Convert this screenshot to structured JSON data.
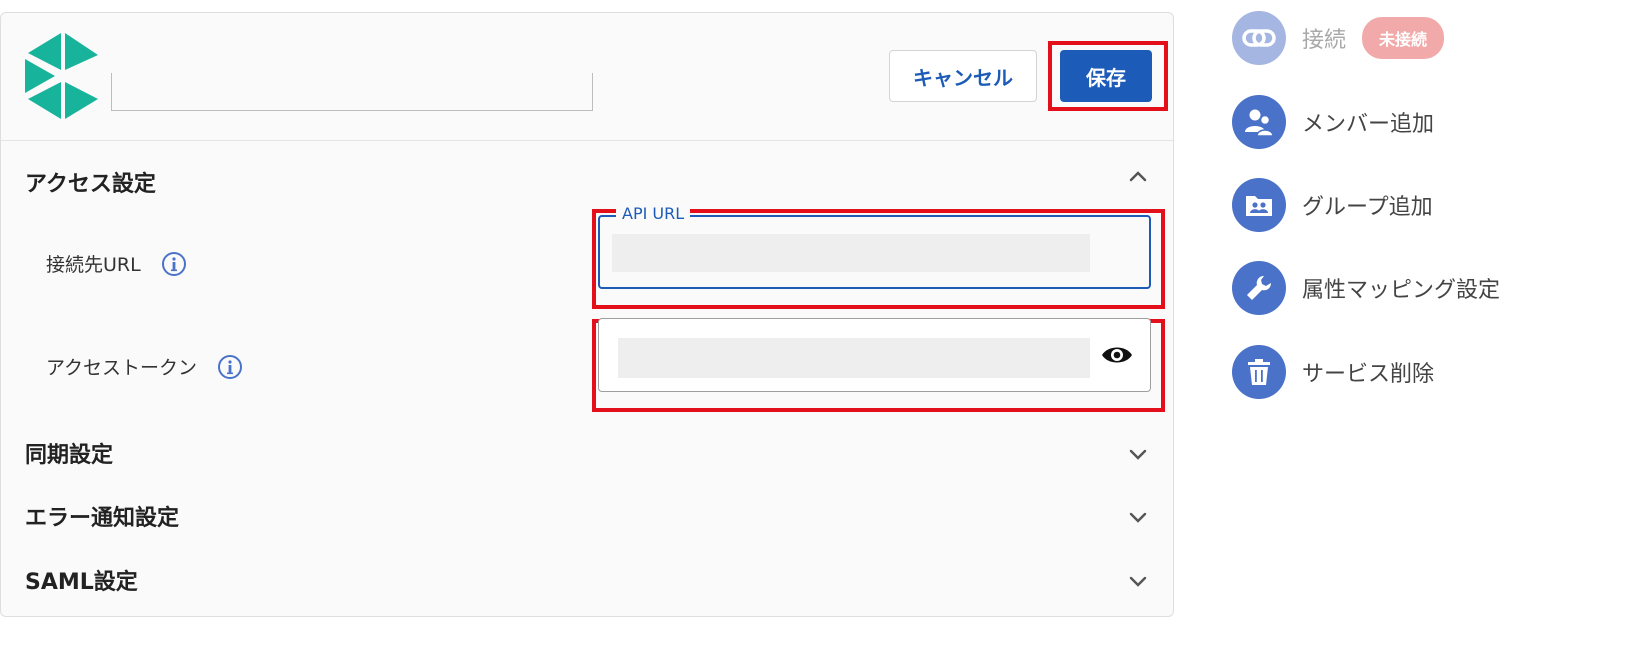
{
  "header": {
    "cancel_label": "キャンセル",
    "save_label": "保存"
  },
  "sections": {
    "access": {
      "title": "アクセス設定",
      "url_label": "接続先URL",
      "url_field_legend": "API URL",
      "token_label": "アクセストークン"
    },
    "sync": {
      "title": "同期設定"
    },
    "error_notify": {
      "title": "エラー通知設定"
    },
    "saml": {
      "title": "SAML設定"
    }
  },
  "sidebar": {
    "connect": {
      "label": "接続",
      "status_badge": "未接続",
      "icon": "link-icon"
    },
    "add_member": {
      "label": "メンバー追加",
      "icon": "add-member-icon"
    },
    "add_group": {
      "label": "グループ追加",
      "icon": "group-folder-icon"
    },
    "attr_mapping": {
      "label": "属性マッピング設定",
      "icon": "wrench-icon"
    },
    "delete_service": {
      "label": "サービス削除",
      "icon": "trash-icon"
    }
  },
  "colors": {
    "accent": "#1c5bb8",
    "highlight": "#e3101c",
    "logo": "#17b49b",
    "sidebar_icon": "#4a72c8",
    "badge": "#f1a9a9"
  }
}
